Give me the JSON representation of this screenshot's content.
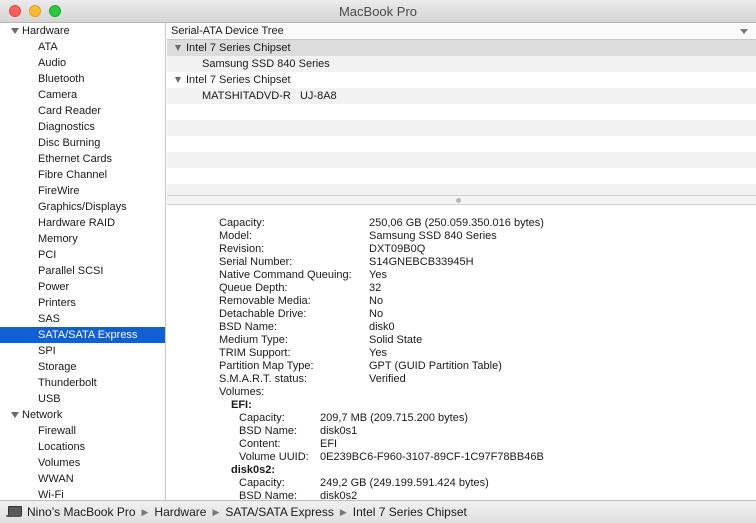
{
  "window": {
    "title": "MacBook Pro"
  },
  "sidebar": {
    "groups": [
      {
        "label": "Hardware",
        "items": [
          "ATA",
          "Audio",
          "Bluetooth",
          "Camera",
          "Card Reader",
          "Diagnostics",
          "Disc Burning",
          "Ethernet Cards",
          "Fibre Channel",
          "FireWire",
          "Graphics/Displays",
          "Hardware RAID",
          "Memory",
          "PCI",
          "Parallel SCSI",
          "Power",
          "Printers",
          "SAS",
          "SATA/SATA Express",
          "SPI",
          "Storage",
          "Thunderbolt",
          "USB"
        ]
      },
      {
        "label": "Network",
        "items": [
          "Firewall",
          "Locations",
          "Volumes",
          "WWAN",
          "Wi-Fi"
        ]
      }
    ],
    "selected": "SATA/SATA Express"
  },
  "tree": {
    "header": "Serial-ATA Device Tree",
    "rows": [
      {
        "label": "Intel 7 Series Chipset",
        "level": 0,
        "expanded": true
      },
      {
        "label": "Samsung SSD 840 Series",
        "level": 1
      },
      {
        "label": "Intel 7 Series Chipset",
        "level": 0,
        "expanded": true
      },
      {
        "label": "MATSHITADVD-R   UJ-8A8",
        "level": 1
      }
    ],
    "selected_index": 0
  },
  "details": [
    {
      "k": "Capacity:",
      "v": "250,06 GB (250.059.350.016 bytes)",
      "indent": 0
    },
    {
      "k": "Model:",
      "v": "Samsung SSD 840 Series",
      "indent": 0
    },
    {
      "k": "Revision:",
      "v": "DXT09B0Q",
      "indent": 0
    },
    {
      "k": "Serial Number:",
      "v": "S14GNEBCB33945H",
      "indent": 0
    },
    {
      "k": "Native Command Queuing:",
      "v": "Yes",
      "indent": 0
    },
    {
      "k": "Queue Depth:",
      "v": "32",
      "indent": 0
    },
    {
      "k": "Removable Media:",
      "v": "No",
      "indent": 0
    },
    {
      "k": "Detachable Drive:",
      "v": "No",
      "indent": 0
    },
    {
      "k": "BSD Name:",
      "v": "disk0",
      "indent": 0
    },
    {
      "k": "Medium Type:",
      "v": "Solid State",
      "indent": 0
    },
    {
      "k": "TRIM Support:",
      "v": "Yes",
      "indent": 0
    },
    {
      "k": "Partition Map Type:",
      "v": "GPT (GUID Partition Table)",
      "indent": 0
    },
    {
      "k": "S.M.A.R.T. status:",
      "v": "Verified",
      "indent": 0
    },
    {
      "k": "Volumes:",
      "v": "",
      "indent": 0
    },
    {
      "k": "EFI:",
      "v": "",
      "indent": 1,
      "bold": true
    },
    {
      "k": "Capacity:",
      "v": "209,7 MB (209.715.200 bytes)",
      "indent": 2
    },
    {
      "k": "BSD Name:",
      "v": "disk0s1",
      "indent": 2
    },
    {
      "k": "Content:",
      "v": "EFI",
      "indent": 2
    },
    {
      "k": "Volume UUID:",
      "v": "0E239BC6-F960-3107-89CF-1C97F78BB46B",
      "indent": 2
    },
    {
      "k": "disk0s2:",
      "v": "",
      "indent": 1,
      "bold": true
    },
    {
      "k": "Capacity:",
      "v": "249,2 GB (249.199.591.424 bytes)",
      "indent": 2
    },
    {
      "k": "BSD Name:",
      "v": "disk0s2",
      "indent": 2
    }
  ],
  "pathbar": {
    "segments": [
      "Nino’s MacBook Pro",
      "Hardware",
      "SATA/SATA Express",
      "Intel 7 Series Chipset"
    ]
  },
  "colors": {
    "selection": "#0f5fd6",
    "tree_selection": "#dcdcdc"
  }
}
